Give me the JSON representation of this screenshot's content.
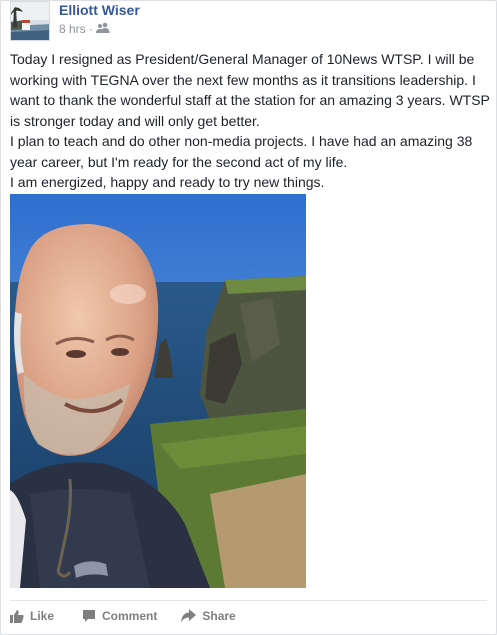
{
  "post": {
    "author": "Elliott Wiser",
    "time": "8 hrs",
    "separator": "·",
    "privacy_icon": "friends-icon",
    "paragraphs": [
      "Today I resigned as President/General Manager of 10News WTSP. I will be working with TEGNA over the next few months as it transitions leadership. I want to thank the wonderful staff at the station for an amazing 3 years. WTSP is stronger today and will only get better.",
      "I plan to teach and do other non-media projects. I have had an amazing 38 year career, but I'm ready for the second act of my life.",
      "I am energized, happy and ready to try new things."
    ],
    "photo_icon": "selfie-photo"
  },
  "actions": {
    "like": {
      "label": "Like",
      "icon": "thumbs-up-icon"
    },
    "comment": {
      "label": "Comment",
      "icon": "comment-bubble-icon"
    },
    "share": {
      "label": "Share",
      "icon": "share-arrow-icon"
    }
  },
  "colors": {
    "name": "#365899",
    "meta": "#90949c",
    "action": "#7f7f7f",
    "text": "#1d2129"
  }
}
